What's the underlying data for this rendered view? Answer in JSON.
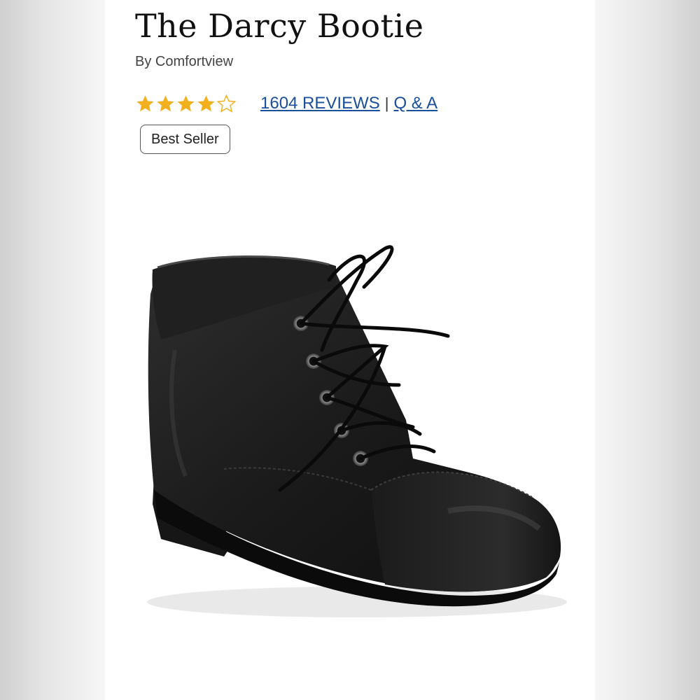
{
  "product": {
    "title": "The Darcy Bootie",
    "brand_line": "By Comfortview",
    "rating": 4.5,
    "rating_max": 5,
    "reviews_link": "1604 REVIEWS",
    "separator": "|",
    "qa_link": "Q & A",
    "badge": "Best Seller",
    "star_color": "#f2b01e",
    "link_color": "#1a4f9c"
  },
  "image": {
    "icon": "black-leather-lace-up-ankle-bootie"
  }
}
